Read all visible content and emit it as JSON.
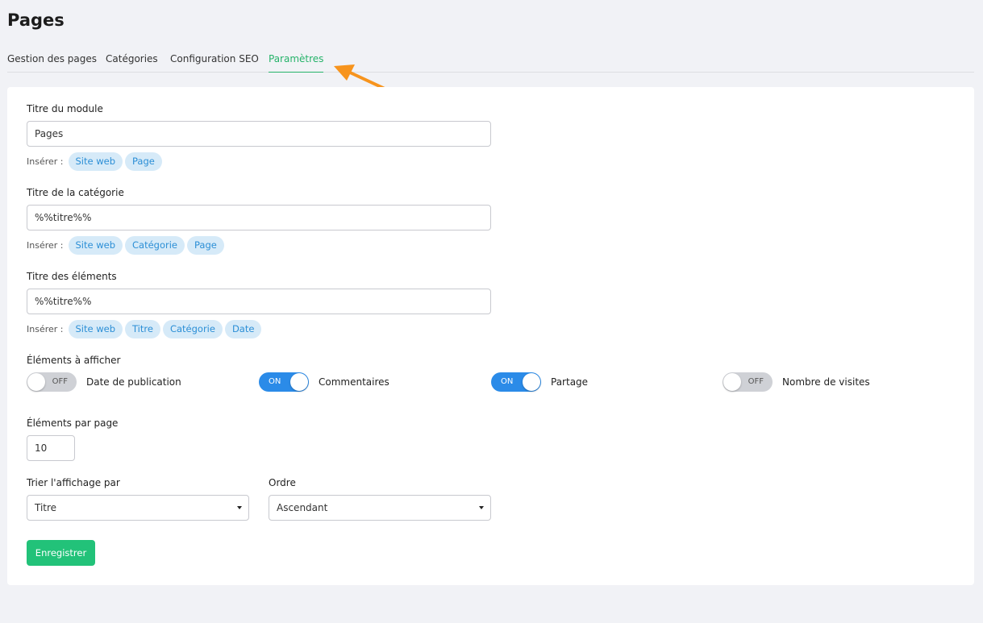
{
  "page": {
    "title": "Pages"
  },
  "tabs": [
    {
      "label": "Gestion des pages"
    },
    {
      "label": "Catégories"
    },
    {
      "label": "Configuration SEO"
    },
    {
      "label": "Paramètres"
    }
  ],
  "colors": {
    "accent": "#26b36a",
    "annotation_arrow": "#f7941d",
    "toggle_on": "#2b8be8",
    "chip_bg": "#d6eaf8",
    "chip_text": "#2c8fd6",
    "button": "#22c279"
  },
  "form": {
    "insert_label": "Insérer :",
    "module_title": {
      "label": "Titre du module",
      "value": "Pages",
      "chips": [
        "Site web",
        "Page"
      ]
    },
    "category_title": {
      "label": "Titre de la catégorie",
      "value": "%%titre%%",
      "chips": [
        "Site web",
        "Catégorie",
        "Page"
      ]
    },
    "elements_title": {
      "label": "Titre des éléments",
      "value": "%%titre%%",
      "chips": [
        "Site web",
        "Titre",
        "Catégorie",
        "Date"
      ]
    },
    "display": {
      "label": "Éléments à afficher",
      "toggles": [
        {
          "label": "Date de publication",
          "state": "OFF"
        },
        {
          "label": "Commentaires",
          "state": "ON"
        },
        {
          "label": "Partage",
          "state": "ON"
        },
        {
          "label": "Nombre de visites",
          "state": "OFF"
        }
      ]
    },
    "per_page": {
      "label": "Éléments par page",
      "value": "10"
    },
    "sort_by": {
      "label": "Trier l'affichage par",
      "value": "Titre"
    },
    "order": {
      "label": "Ordre",
      "value": "Ascendant"
    },
    "save_label": "Enregistrer"
  }
}
